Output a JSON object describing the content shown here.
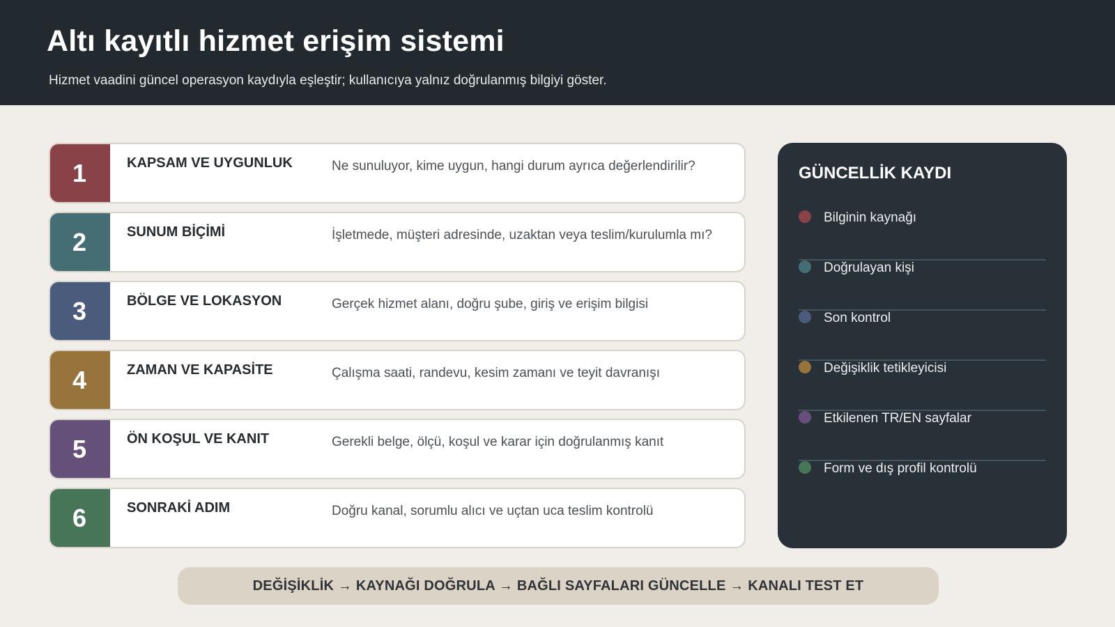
{
  "header": {
    "title": "Altı kayıtlı hizmet erişim sistemi",
    "subtitle": "Hizmet vaadini güncel operasyon kaydıyla eşleştir; kullanıcıya yalnız doğrulanmış bilgiyi göster.",
    "background_color": "#222a2f"
  },
  "steps": [
    {
      "number": "1",
      "title": "KAPSAM VE UYGUNLUK",
      "description": "Ne sunuluyor, kime uygun, hangi durum ayrıca değerlendirilir?",
      "color": "#8a4249"
    },
    {
      "number": "2",
      "title": "SUNUM BİÇİMİ",
      "description": "İşletmede, müşteri adresinde, uzaktan veya teslim/kurulumla mı?",
      "color": "#456e74"
    },
    {
      "number": "3",
      "title": "BÖLGE VE LOKASYON",
      "description": "Gerçek hizmet alanı, doğru şube, giriş ve erişim bilgisi",
      "color": "#4a5b7c"
    },
    {
      "number": "4",
      "title": "ZAMAN VE KAPASİTE",
      "description": "Çalışma saati, randevu, kesim zamanı ve teyit davranışı",
      "color": "#97743b"
    },
    {
      "number": "5",
      "title": "ÖN KOŞUL VE KANIT",
      "description": "Gerekli belge, ölçü, koşul ve karar için doğrulanmış kanıt",
      "color": "#65507a"
    },
    {
      "number": "6",
      "title": "SONRAKİ ADIM",
      "description": "Doğru kanal, sorumlu alıcı ve uçtan uca teslim kontrolü",
      "color": "#467657"
    }
  ],
  "panel": {
    "title": "GÜNCELLİK KAYDI",
    "background_color": "#283038",
    "items": [
      {
        "label": "Bilginin kaynağı",
        "color": "#8a4249"
      },
      {
        "label": "Doğrulayan kişi",
        "color": "#456e74"
      },
      {
        "label": "Son kontrol",
        "color": "#4a5b7c"
      },
      {
        "label": "Değişiklik tetikleyicisi",
        "color": "#97743b"
      },
      {
        "label": "Etkilenen TR/EN sayfalar",
        "color": "#65507a"
      },
      {
        "label": "Form ve dış profil kontrolü",
        "color": "#467657"
      }
    ]
  },
  "footer": {
    "text": "DEĞİŞİKLİK → KAYNAĞI DOĞRULA → BAĞLI SAYFALARI GÜNCELLE → KANALI TEST ET"
  }
}
